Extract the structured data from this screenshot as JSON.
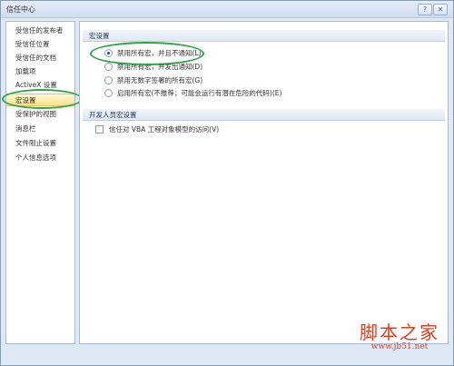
{
  "window": {
    "title": "信任中心",
    "help_glyph": "?",
    "close_glyph": "✕"
  },
  "sidebar": {
    "items": [
      {
        "label": "受信任的发布者"
      },
      {
        "label": "受信任位置"
      },
      {
        "label": "受信任的文档"
      },
      {
        "label": "加载项"
      },
      {
        "label": "ActiveX 设置"
      },
      {
        "label": "宏设置",
        "selected": true
      },
      {
        "label": "受保护的视图"
      },
      {
        "label": "消息栏"
      },
      {
        "label": "文件阻止设置"
      },
      {
        "label": "个人信息选项"
      }
    ]
  },
  "macro_settings": {
    "header": "宏设置",
    "options": [
      {
        "label": "禁用所有宏，并且不通知(L)",
        "checked": true
      },
      {
        "label": "禁用所有宏，并发出通知(D)",
        "checked": false
      },
      {
        "label": "禁用无数字签署的所有宏(G)",
        "checked": false
      },
      {
        "label": "启用所有宏(不推荐；可能会运行有潜在危险的代码)(E)",
        "checked": false
      }
    ]
  },
  "developer_settings": {
    "header": "开发人员宏设置",
    "vba_trust_label": "信任对 VBA 工程对象模型的访问(V)",
    "vba_trust_checked": false
  },
  "watermark": {
    "logo": "脚本之家",
    "url": "www.jb51.net"
  },
  "colors": {
    "annotation_circle": "#2ca448",
    "selected_nav": "#ffe18a",
    "watermark": "#e23c1d"
  }
}
